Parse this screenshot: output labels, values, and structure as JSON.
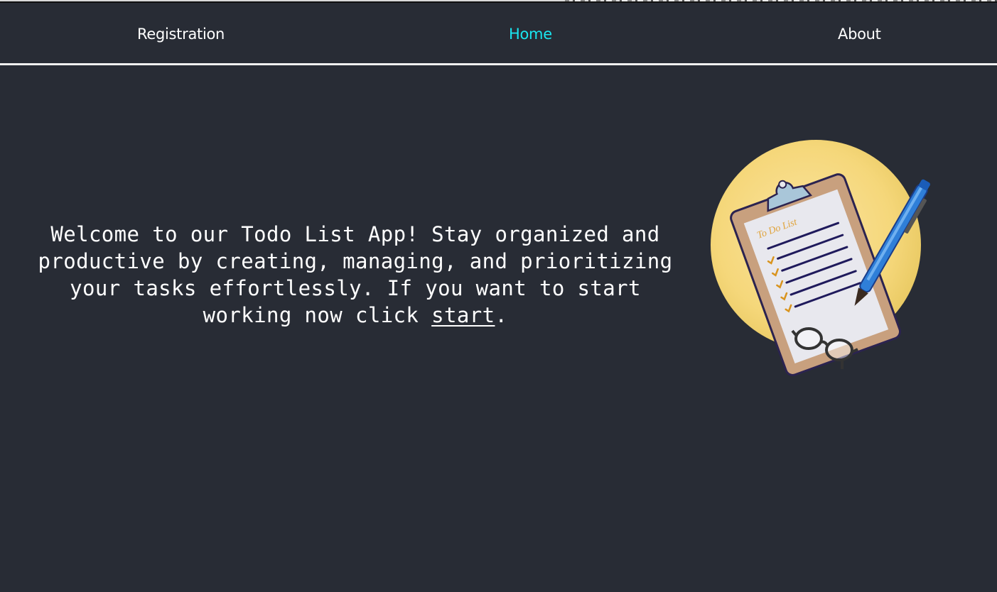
{
  "nav": {
    "items": [
      {
        "label": "Registration",
        "active": false
      },
      {
        "label": "Home",
        "active": true
      },
      {
        "label": "About",
        "active": false
      }
    ],
    "active_color": "#19e6f0"
  },
  "hero": {
    "text_before_link": "Welcome to our Todo List App! Stay organized and productive by creating, managing, and prioritizing your tasks effortlessly. If you want to start working now click ",
    "link_label": "start",
    "text_after_link": "."
  },
  "illustration": {
    "clipboard_title": "To Do List",
    "icon": "clipboard-todo-illustration"
  },
  "colors": {
    "background": "#282c35",
    "text": "#ffffff",
    "accent": "#19e6f0",
    "sun": "#f5d77a"
  }
}
